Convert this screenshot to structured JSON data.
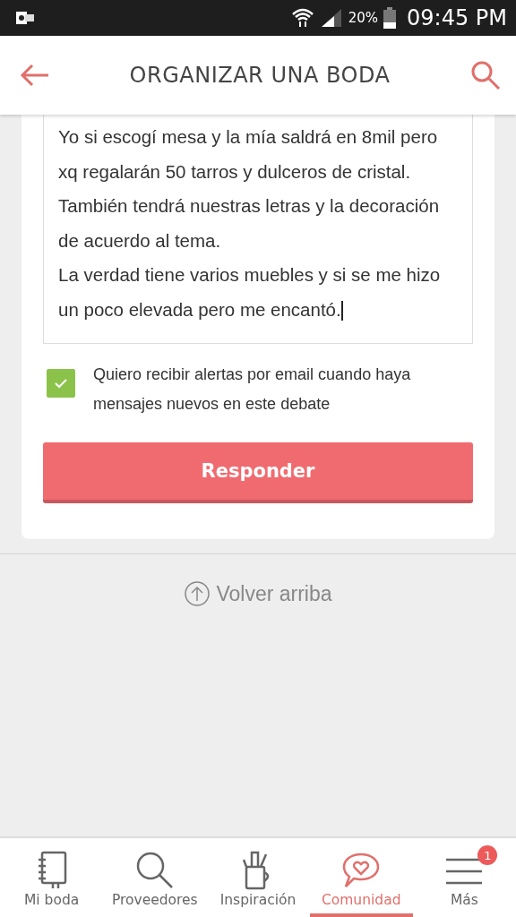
{
  "status_bar": {
    "battery": "20%",
    "time": "09:45 PM"
  },
  "header": {
    "title": "ORGANIZAR UNA BODA"
  },
  "reply": {
    "value": "Yo si escogí mesa y la mía saldrá en 8mil pero xq regalarán 50 tarros y dulceros de cristal. También tendrá nuestras letras y la decoración de acuerdo al tema.\nLa verdad tiene varios muebles y si se me hizo un poco elevada pero me encantó.",
    "alerts": {
      "label": "Quiero recibir alertas por email cuando haya mensajes nuevos en este debate",
      "checked": true
    },
    "button": "Responder"
  },
  "back_to_top": "Volver arriba",
  "nav": [
    {
      "kind": "notebook",
      "label": "Mi boda",
      "selected": false
    },
    {
      "kind": "search",
      "label": "Proveedores",
      "selected": false
    },
    {
      "kind": "mug",
      "label": "Inspiración",
      "selected": false
    },
    {
      "kind": "chat",
      "label": "Comunidad",
      "selected": true
    },
    {
      "kind": "menu",
      "label": "Más",
      "selected": false,
      "badge": "1"
    }
  ]
}
